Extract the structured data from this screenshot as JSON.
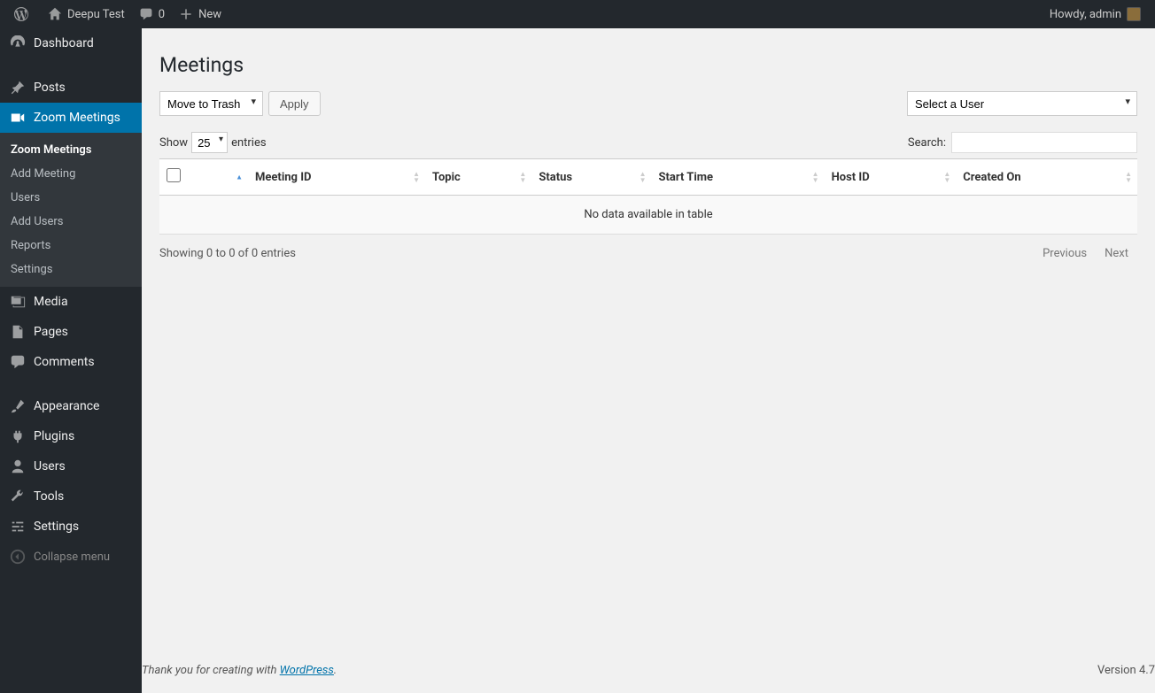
{
  "adminbar": {
    "site_name": "Deepu Test",
    "comments_count": "0",
    "new_label": "New",
    "greeting": "Howdy, admin"
  },
  "sidebar": {
    "dashboard": "Dashboard",
    "posts": "Posts",
    "zoom_meetings": "Zoom Meetings",
    "submenu": {
      "zoom_meetings": "Zoom Meetings",
      "add_meeting": "Add Meeting",
      "users": "Users",
      "add_users": "Add Users",
      "reports": "Reports",
      "settings": "Settings"
    },
    "media": "Media",
    "pages": "Pages",
    "comments": "Comments",
    "appearance": "Appearance",
    "plugins": "Plugins",
    "users": "Users",
    "tools": "Tools",
    "settings": "Settings",
    "collapse": "Collapse menu"
  },
  "page": {
    "title": "Meetings",
    "bulk_action_selected": "Move to Trash",
    "apply_label": "Apply",
    "user_select_placeholder": "Select a User",
    "show_label_pre": "Show",
    "show_value": "25",
    "show_label_post": "entries",
    "search_label": "Search:",
    "columns": {
      "meeting_id": "Meeting ID",
      "topic": "Topic",
      "status": "Status",
      "start_time": "Start Time",
      "host_id": "Host ID",
      "created_on": "Created On"
    },
    "no_data": "No data available in table",
    "info": "Showing 0 to 0 of 0 entries",
    "prev_label": "Previous",
    "next_label": "Next"
  },
  "footer": {
    "thank_you_pre": "Thank you for creating with ",
    "wordpress": "WordPress",
    "period": ".",
    "version": "Version 4.7"
  }
}
